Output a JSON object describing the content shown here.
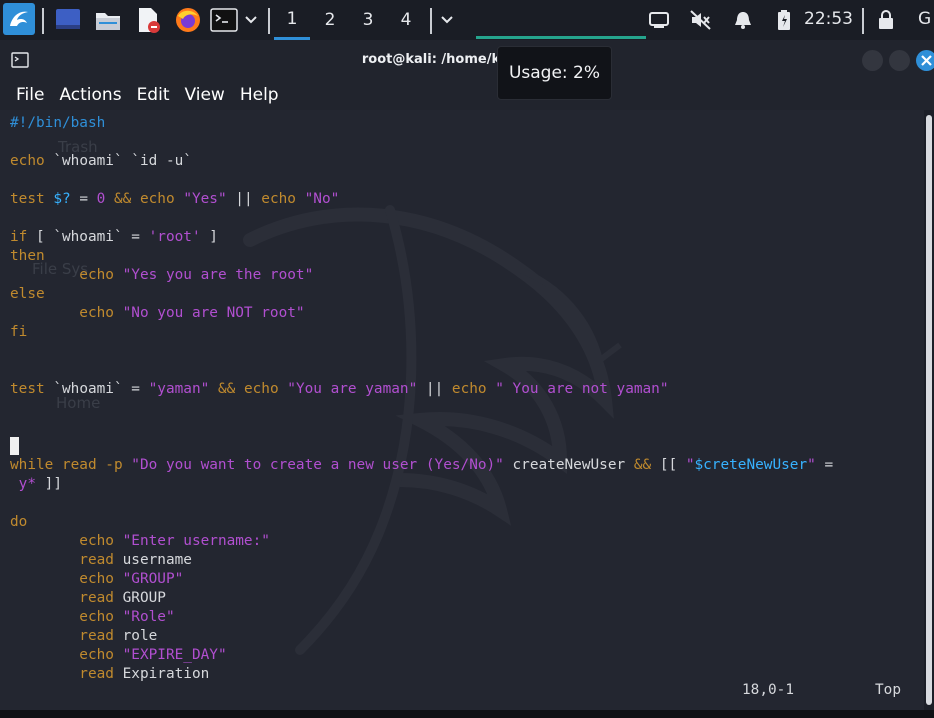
{
  "panel": {
    "workspaces": [
      "1",
      "2",
      "3",
      "4"
    ],
    "active_workspace": "1",
    "clock": "22:53",
    "launcher_icons": [
      "kali-menu-icon",
      "desktop-icon",
      "file-manager-icon",
      "text-editor-icon",
      "firefox-icon",
      "terminal-icon"
    ],
    "tray_icons": [
      "display-icon",
      "volume-muted-icon",
      "notification-bell-icon",
      "battery-icon",
      "lock-icon"
    ],
    "overflow_label": "G"
  },
  "window": {
    "title": "root@kali: /home/kali/scripts",
    "menu": [
      "File",
      "Actions",
      "Edit",
      "View",
      "Help"
    ]
  },
  "tooltip": {
    "text": "Usage: 2%"
  },
  "background_labels": [
    "Trash",
    "File Sys",
    "Home"
  ],
  "code_lines": [
    [
      {
        "t": "#!/bin/bash",
        "c": "com"
      }
    ],
    [],
    [
      {
        "t": "echo ",
        "c": "kw"
      },
      {
        "t": "`whoami` `id -u`",
        "c": "pl"
      }
    ],
    [],
    [
      {
        "t": "test ",
        "c": "kw"
      },
      {
        "t": "$?",
        "c": "var"
      },
      {
        "t": " = ",
        "c": "pl"
      },
      {
        "t": "0",
        "c": "str"
      },
      {
        "t": " && ",
        "c": "op"
      },
      {
        "t": "echo ",
        "c": "kw"
      },
      {
        "t": "\"Yes\"",
        "c": "str"
      },
      {
        "t": " || ",
        "c": "pl"
      },
      {
        "t": "echo ",
        "c": "kw"
      },
      {
        "t": "\"No\"",
        "c": "str"
      }
    ],
    [],
    [
      {
        "t": "if",
        "c": "kw"
      },
      {
        "t": " [ `whoami` = ",
        "c": "pl"
      },
      {
        "t": "'root'",
        "c": "str"
      },
      {
        "t": " ]",
        "c": "pl"
      }
    ],
    [
      {
        "t": "then",
        "c": "kw"
      }
    ],
    [
      {
        "t": "        echo ",
        "c": "kw"
      },
      {
        "t": "\"Yes you are the root\"",
        "c": "str"
      }
    ],
    [
      {
        "t": "else",
        "c": "kw"
      }
    ],
    [
      {
        "t": "        echo ",
        "c": "kw"
      },
      {
        "t": "\"No you are NOT root\"",
        "c": "str"
      }
    ],
    [
      {
        "t": "fi",
        "c": "kw"
      }
    ],
    [],
    [],
    [
      {
        "t": "test ",
        "c": "kw"
      },
      {
        "t": "`whoami` = ",
        "c": "pl"
      },
      {
        "t": "\"yaman\"",
        "c": "str"
      },
      {
        "t": " && ",
        "c": "op"
      },
      {
        "t": "echo ",
        "c": "kw"
      },
      {
        "t": "\"You are yaman\"",
        "c": "str"
      },
      {
        "t": " || ",
        "c": "pl"
      },
      {
        "t": "echo ",
        "c": "kw"
      },
      {
        "t": "\" You are not yaman\"",
        "c": "str"
      }
    ],
    [],
    [],
    [
      {
        "t": "",
        "c": "cursor"
      }
    ],
    [
      {
        "t": "while read -p ",
        "c": "kw"
      },
      {
        "t": "\"Do you want to create a new user (Yes/No)\"",
        "c": "str"
      },
      {
        "t": " createNewUser ",
        "c": "pl"
      },
      {
        "t": "&&",
        "c": "op"
      },
      {
        "t": " [[ ",
        "c": "pl"
      },
      {
        "t": "\"",
        "c": "str"
      },
      {
        "t": "$creteNewUser",
        "c": "var"
      },
      {
        "t": "\"",
        "c": "str"
      },
      {
        "t": " =",
        "c": "pl"
      }
    ],
    [
      {
        "t": " y*",
        "c": "str"
      },
      {
        "t": " ]]",
        "c": "pl"
      }
    ],
    [],
    [
      {
        "t": "do",
        "c": "kw"
      }
    ],
    [
      {
        "t": "        echo ",
        "c": "kw"
      },
      {
        "t": "\"Enter username:\"",
        "c": "str"
      }
    ],
    [
      {
        "t": "        read ",
        "c": "kw"
      },
      {
        "t": "username",
        "c": "pl"
      }
    ],
    [
      {
        "t": "        echo ",
        "c": "kw"
      },
      {
        "t": "\"GROUP\"",
        "c": "str"
      }
    ],
    [
      {
        "t": "        read ",
        "c": "kw"
      },
      {
        "t": "GROUP",
        "c": "pl"
      }
    ],
    [
      {
        "t": "        echo ",
        "c": "kw"
      },
      {
        "t": "\"Role\"",
        "c": "str"
      }
    ],
    [
      {
        "t": "        read ",
        "c": "kw"
      },
      {
        "t": "role",
        "c": "pl"
      }
    ],
    [
      {
        "t": "        echo ",
        "c": "kw"
      },
      {
        "t": "\"EXPIRE_DAY\"",
        "c": "str"
      }
    ],
    [
      {
        "t": "        read ",
        "c": "kw"
      },
      {
        "t": "Expiration",
        "c": "pl"
      }
    ]
  ],
  "status": {
    "position": "18,0-1",
    "scroll": "Top"
  },
  "colors": {
    "accent": "#2f8fd8",
    "keyword": "#c08a2e",
    "string": "#b14fd0",
    "variable": "#37b2ff",
    "comment": "#2f8fd8"
  }
}
